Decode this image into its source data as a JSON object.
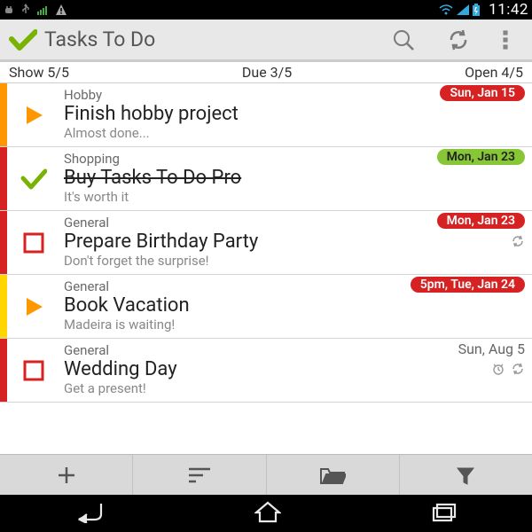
{
  "statusbar": {
    "clock": "11:42"
  },
  "header": {
    "title": "Tasks To Do"
  },
  "filters": {
    "show": "Show 5/5",
    "due": "Due 3/5",
    "open": "Open 4/5"
  },
  "tasks": [
    {
      "category": "Hobby",
      "title": "Finish hobby project",
      "note": "Almost done...",
      "due": "Sun, Jan 15"
    },
    {
      "category": "Shopping",
      "title": "Buy Tasks To Do Pro",
      "note": "It's worth it",
      "due": "Mon, Jan 23"
    },
    {
      "category": "General",
      "title": "Prepare Birthday Party",
      "note": "Don't forget the surprise!",
      "due": "Mon, Jan 23"
    },
    {
      "category": "General",
      "title": "Book Vacation",
      "note": "Madeira is waiting!",
      "due": "5pm, Tue, Jan 24"
    },
    {
      "category": "General",
      "title": "Wedding Day",
      "note": "Get a present!",
      "due": "Sun, Aug 5"
    }
  ]
}
